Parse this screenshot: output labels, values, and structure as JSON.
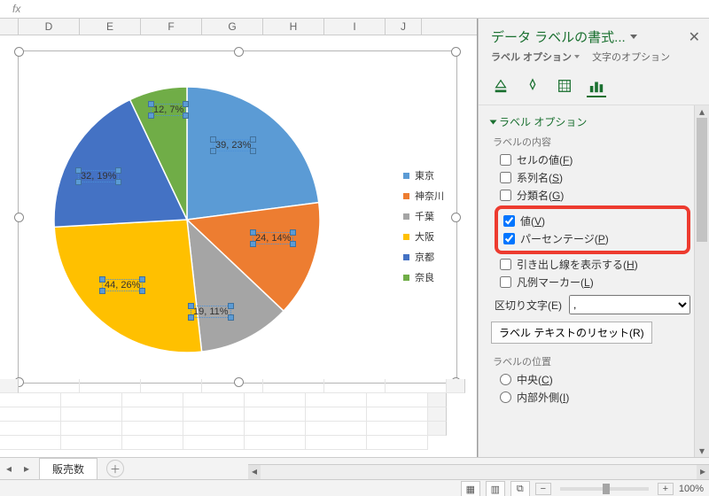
{
  "chart_data": {
    "type": "pie",
    "title": "",
    "series_name": "販売数",
    "slices": [
      {
        "name": "東京",
        "value": 39,
        "pct": 23,
        "color": "#5B9BD5"
      },
      {
        "name": "神奈川",
        "value": 24,
        "pct": 14,
        "color": "#ED7D31"
      },
      {
        "name": "千葉",
        "value": 19,
        "pct": 11,
        "color": "#A5A5A5"
      },
      {
        "name": "大阪",
        "value": 44,
        "pct": 26,
        "color": "#FFC000"
      },
      {
        "name": "京都",
        "value": 32,
        "pct": 19,
        "color": "#4472C4"
      },
      {
        "name": "奈良",
        "value": 12,
        "pct": 7,
        "color": "#70AD47"
      }
    ]
  },
  "columns": [
    "D",
    "E",
    "F",
    "G",
    "H",
    "I",
    "J"
  ],
  "pane": {
    "title": "データ ラベルの書式...",
    "sub_label": "ラベル オプション",
    "sub_text": "文字のオプション",
    "section": "ラベル オプション",
    "group_content": "ラベルの内容",
    "opts": {
      "cell": {
        "label": "セルの値",
        "acc": "F",
        "checked": false
      },
      "series": {
        "label": "系列名",
        "acc": "S",
        "checked": false
      },
      "cat": {
        "label": "分類名",
        "acc": "G",
        "checked": false
      },
      "value": {
        "label": "値",
        "acc": "V",
        "checked": true
      },
      "pct": {
        "label": "パーセンテージ",
        "acc": "P",
        "checked": true
      },
      "leader": {
        "label": "引き出し線を表示する",
        "acc": "H",
        "checked": false
      },
      "marker": {
        "label": "凡例マーカー",
        "acc": "L",
        "checked": false
      }
    },
    "sep_label": "区切り文字",
    "sep_acc": "E",
    "sep_value": ",",
    "reset": "ラベル テキストのリセット",
    "reset_acc": "R",
    "group_pos": "ラベルの位置",
    "pos": {
      "center": {
        "label": "中央",
        "acc": "C"
      },
      "inside": {
        "label": "内部外側",
        "acc": "I"
      }
    }
  },
  "tabs": {
    "sheet": "販売数"
  },
  "status": {
    "zoom": "100%"
  }
}
